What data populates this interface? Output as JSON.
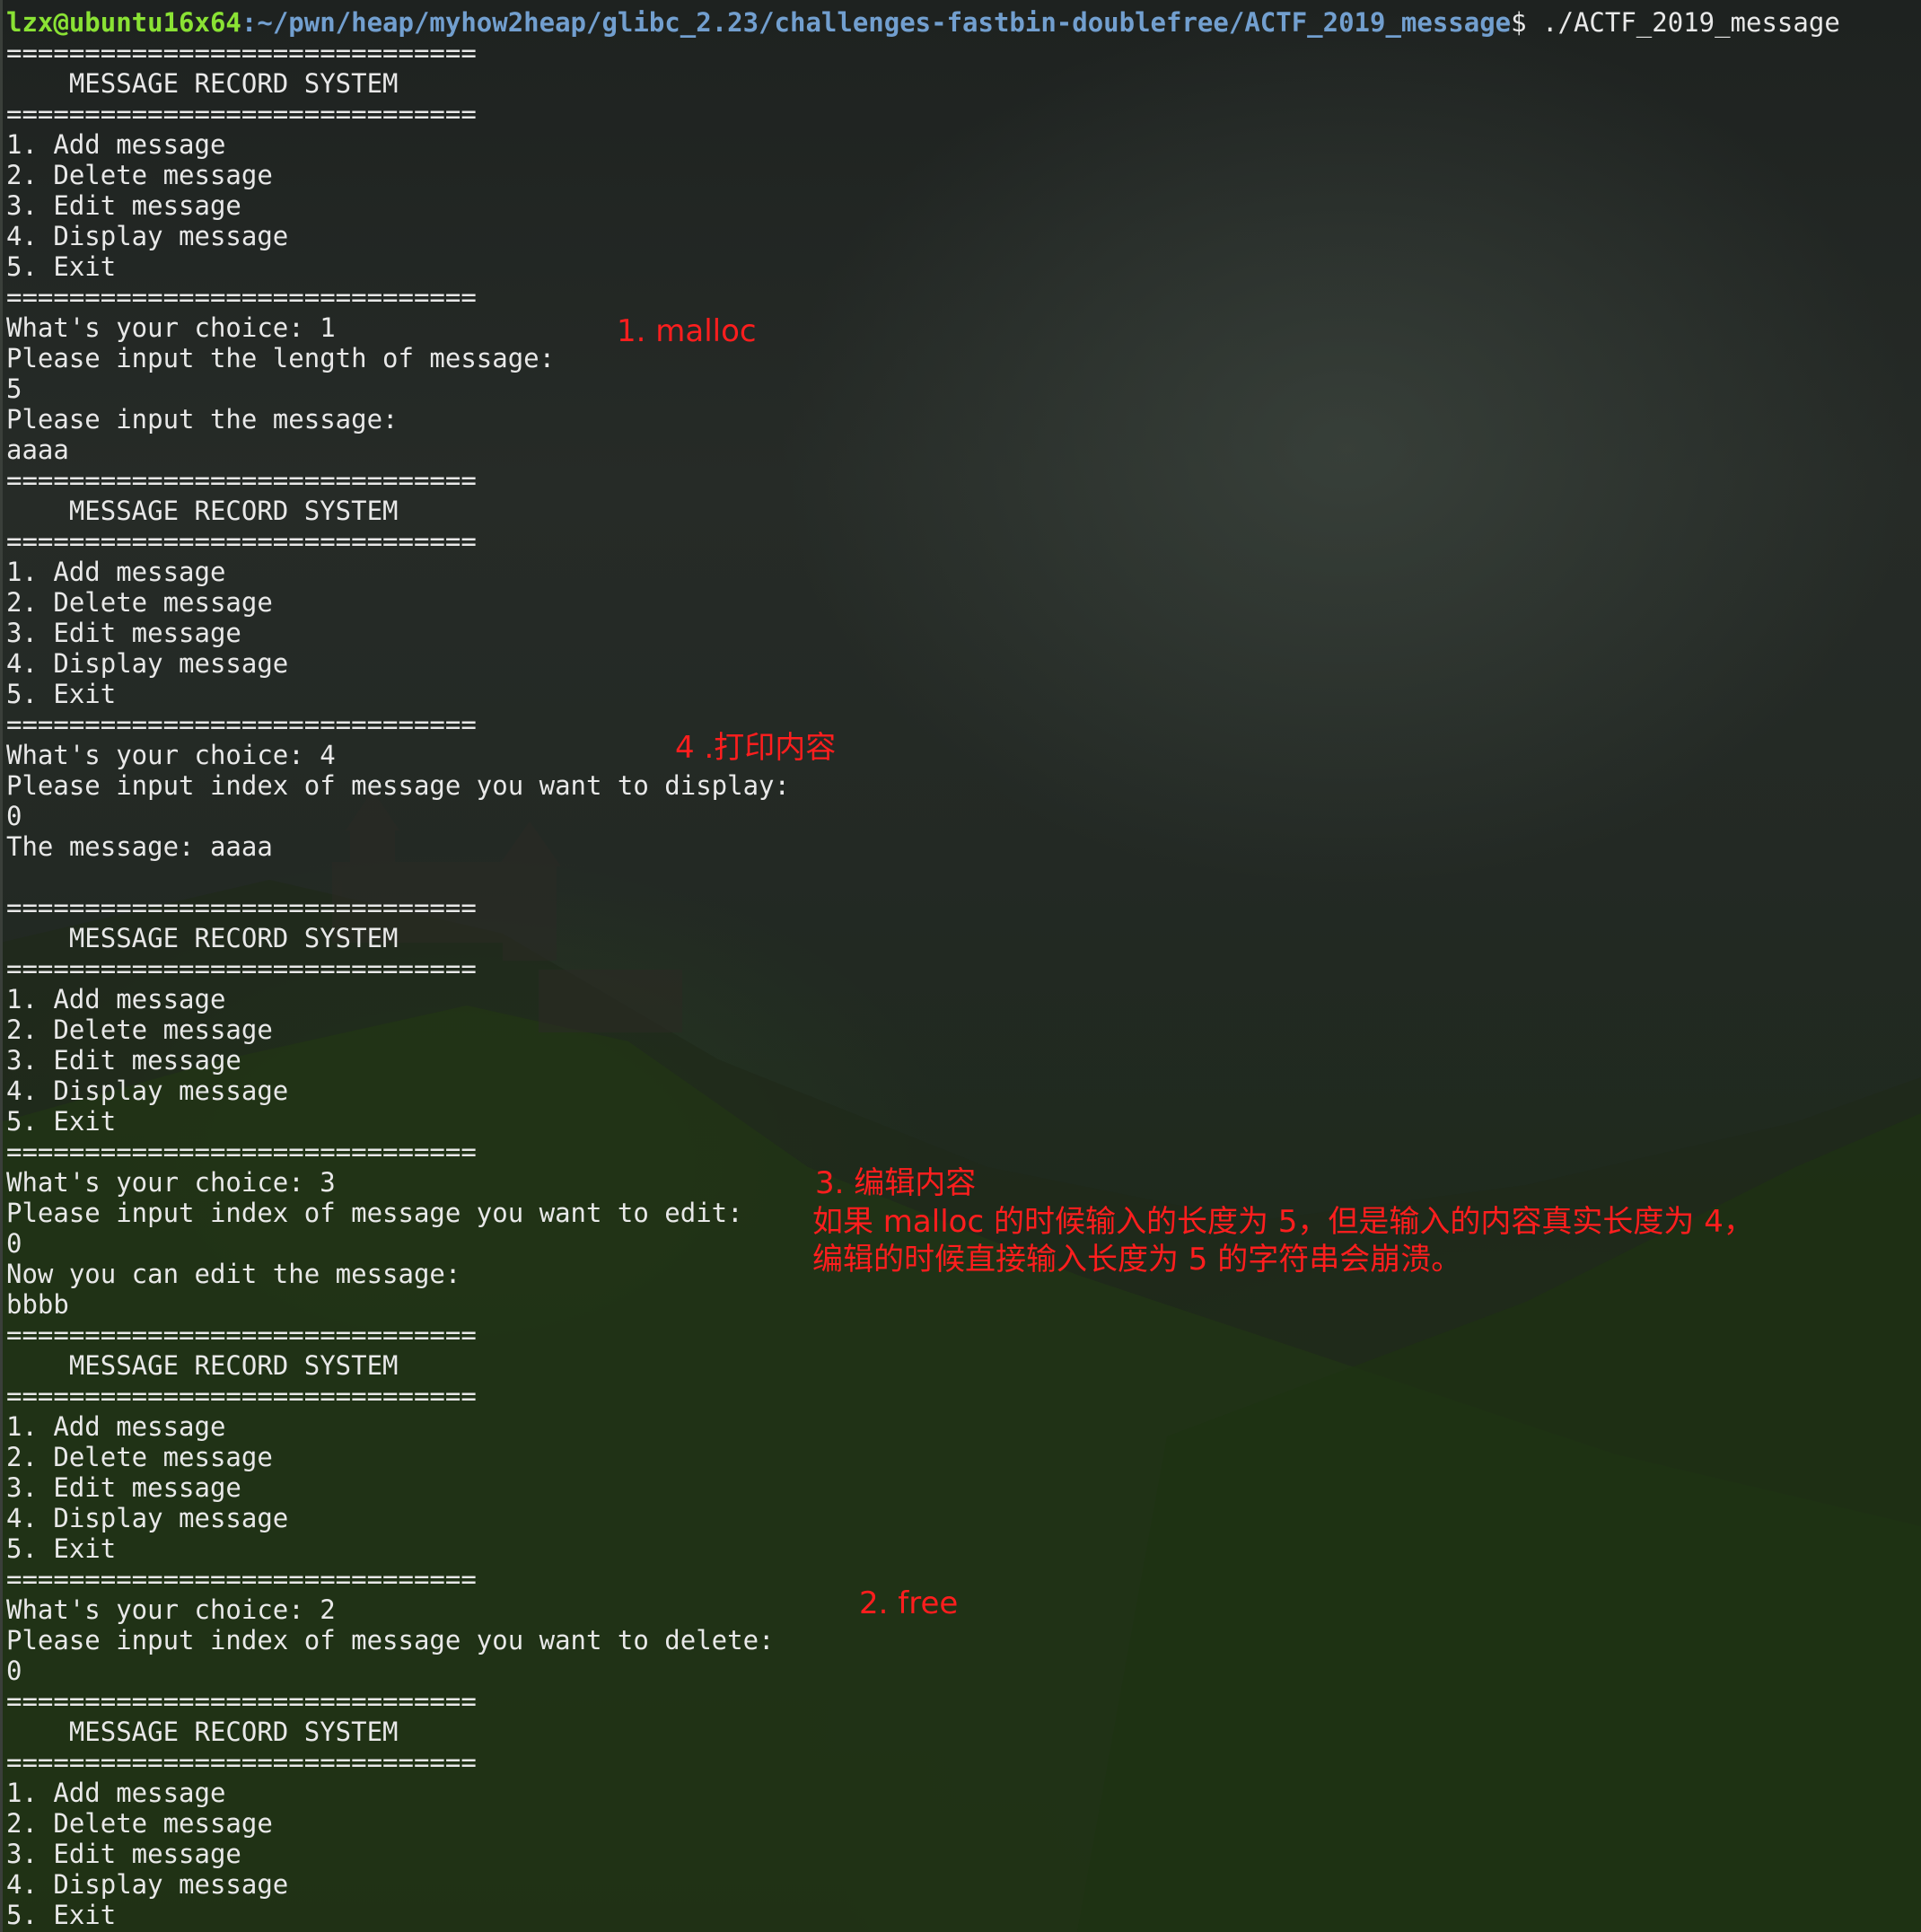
{
  "terminal": {
    "prompt": {
      "user_host": "lzx@ubuntu16x64",
      "path": ":~/pwn/heap/myhow2heap/glibc_2.23/challenges-fastbin-doublefree/ACTF_2019_message",
      "command": "$ ./ACTF_2019_message"
    },
    "lines": [
      "==============================",
      "    MESSAGE RECORD SYSTEM",
      "==============================",
      "1. Add message",
      "2. Delete message",
      "3. Edit message",
      "4. Display message",
      "5. Exit",
      "==============================",
      "What's your choice: 1",
      "Please input the length of message:",
      "5",
      "Please input the message:",
      "aaaa",
      "==============================",
      "    MESSAGE RECORD SYSTEM",
      "==============================",
      "1. Add message",
      "2. Delete message",
      "3. Edit message",
      "4. Display message",
      "5. Exit",
      "==============================",
      "What's your choice: 4",
      "Please input index of message you want to display:",
      "0",
      "The message: aaaa",
      "",
      "==============================",
      "    MESSAGE RECORD SYSTEM",
      "==============================",
      "1. Add message",
      "2. Delete message",
      "3. Edit message",
      "4. Display message",
      "5. Exit",
      "==============================",
      "What's your choice: 3",
      "Please input index of message you want to edit:",
      "0",
      "Now you can edit the message:",
      "bbbb",
      "==============================",
      "    MESSAGE RECORD SYSTEM",
      "==============================",
      "1. Add message",
      "2. Delete message",
      "3. Edit message",
      "4. Display message",
      "5. Exit",
      "==============================",
      "What's your choice: 2",
      "Please input index of message you want to delete:",
      "0",
      "==============================",
      "    MESSAGE RECORD SYSTEM",
      "==============================",
      "1. Add message",
      "2. Delete message",
      "3. Edit message",
      "4. Display message",
      "5. Exit"
    ]
  },
  "annotations": {
    "malloc": "1. malloc",
    "display": "4 .打印内容",
    "edit_title": "3. 编辑内容",
    "edit_note_1": "如果 malloc 的时候输入的长度为 5，但是输入的内容真实长度为 4，",
    "edit_note_2": "编辑的时候直接输入长度为 5 的字符串会崩溃。",
    "free": "2. free"
  },
  "colors": {
    "text": "#e8e8e8",
    "prompt_user": "#8ae234",
    "prompt_path": "#729fcf",
    "annotation": "#ff1e1e"
  }
}
